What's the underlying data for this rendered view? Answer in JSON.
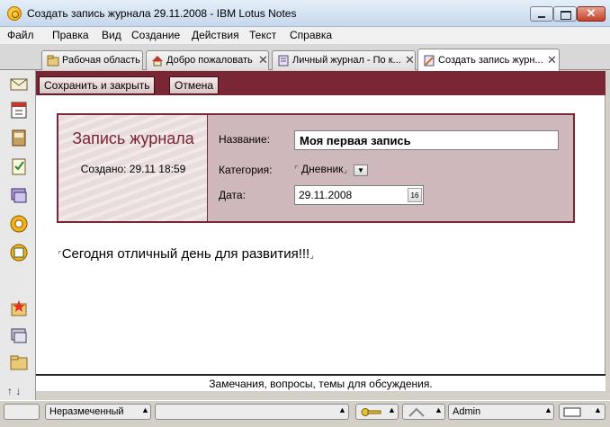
{
  "window": {
    "title": "Создать запись журнала 29.11.2008 - IBM Lotus Notes"
  },
  "menu": [
    "Файл",
    "Правка",
    "Вид",
    "Создание",
    "Действия",
    "Текст",
    "Справка"
  ],
  "tabs": [
    {
      "label": "Рабочая область",
      "icon": "workspace-icon"
    },
    {
      "label": "Добро пожаловать",
      "icon": "home-icon"
    },
    {
      "label": "Личный журнал - По к...",
      "icon": "journal-icon"
    },
    {
      "label": "Создать запись журн...",
      "icon": "new-entry-icon"
    }
  ],
  "toolbar": {
    "save_close": "Сохранить и закрыть",
    "cancel": "Отмена"
  },
  "form": {
    "heading": "Запись журнала",
    "created": "Создано: 29.11 18:59",
    "name_label": "Название:",
    "name_value": "Моя первая запись",
    "category_label": "Категория:",
    "category_value": "Дневник",
    "date_label": "Дата:",
    "date_value": "29.11.2008",
    "calendar_glyph": "16"
  },
  "body": {
    "text": "Сегодня отличный день для развития!!!"
  },
  "notes": {
    "text": "Замечания, вопросы, темы для обсуждения."
  },
  "status": {
    "style": "Неразмеченный",
    "user": "Admin"
  },
  "colors": {
    "accent": "#7b2634",
    "header_bg": "#cfb8bc"
  }
}
